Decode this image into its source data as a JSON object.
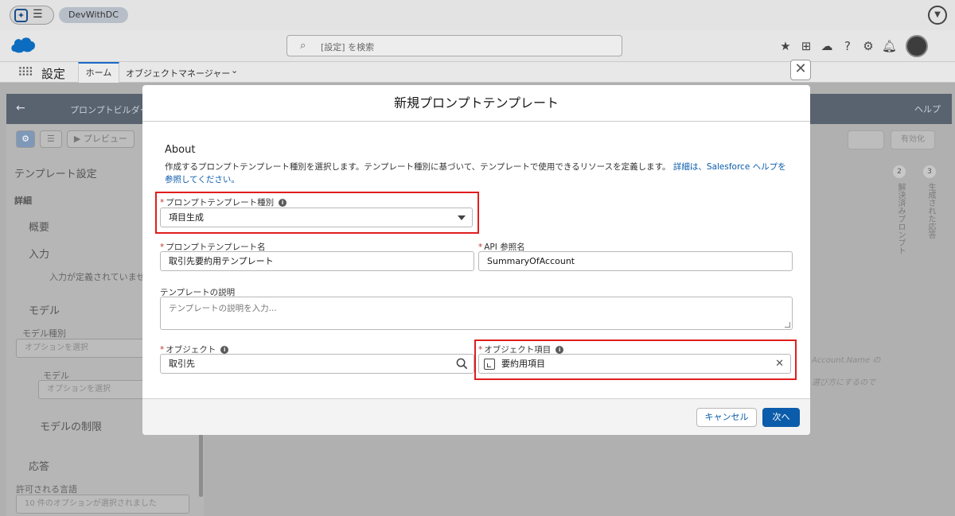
{
  "topbar": {
    "org_name": "DevWithDC"
  },
  "header": {
    "search_placeholder": "[設定] を検索"
  },
  "navbar": {
    "app_title": "設定",
    "tab_home": "ホーム",
    "tab_object_manager": "オブジェクトマネージャー"
  },
  "builder": {
    "title": "プロンプトビルダー",
    "help_label": "ヘルプ",
    "toolbar_preview": "プレビュー",
    "panel_title": "テンプレート設定",
    "tab_details": "詳細",
    "section_overview": "概要",
    "section_input": "入力",
    "input_empty": "入力が定義されていませんが",
    "section_model": "モデル",
    "model_type_label": "モデル種別",
    "model_type_placeholder": "オプションを選択",
    "model_label": "モデル",
    "model_placeholder": "オプションを選択",
    "section_model_limits": "モデルの制限",
    "section_response": "応答",
    "allowed_languages_label": "許可される言語",
    "allowed_languages_value": "10 件のオプションが選択されました",
    "step2_num": "2",
    "step2_label": "解決済みプロンプト",
    "step3_num": "3",
    "step3_label": "生成された応答",
    "activate_label": "有効化",
    "faint_text_1": "Account.Name の",
    "faint_text_2": "選び方にするので"
  },
  "modal": {
    "title": "新規プロンプトテンプレート",
    "section_title": "About",
    "description": "作成するプロンプトテンプレート種別を選択します。テンプレート種別に基づいて、テンプレートで使用できるリソースを定義します。",
    "description_link": "詳細は、Salesforce ヘルプを参照してください。",
    "required_mark": "*",
    "info_glyph": "i",
    "template_type_label": "プロンプトテンプレート種別",
    "template_type_value": "項目生成",
    "template_name_label": "プロンプトテンプレート名",
    "template_name_value": "取引先要約用テンプレート",
    "api_name_label": "API 参照名",
    "api_name_value": "SummaryOfAccount",
    "description_field_label": "テンプレートの説明",
    "description_field_placeholder": "テンプレートの説明を入力...",
    "object_label": "オブジェクト",
    "object_value": "取引先",
    "object_field_label": "オブジェクト項目",
    "object_field_value": "要約用項目",
    "cancel_label": "キャンセル",
    "next_label": "次へ"
  },
  "colors": {
    "brand": "#0b5cab",
    "highlight": "#e01e1e",
    "required": "#c23934"
  }
}
